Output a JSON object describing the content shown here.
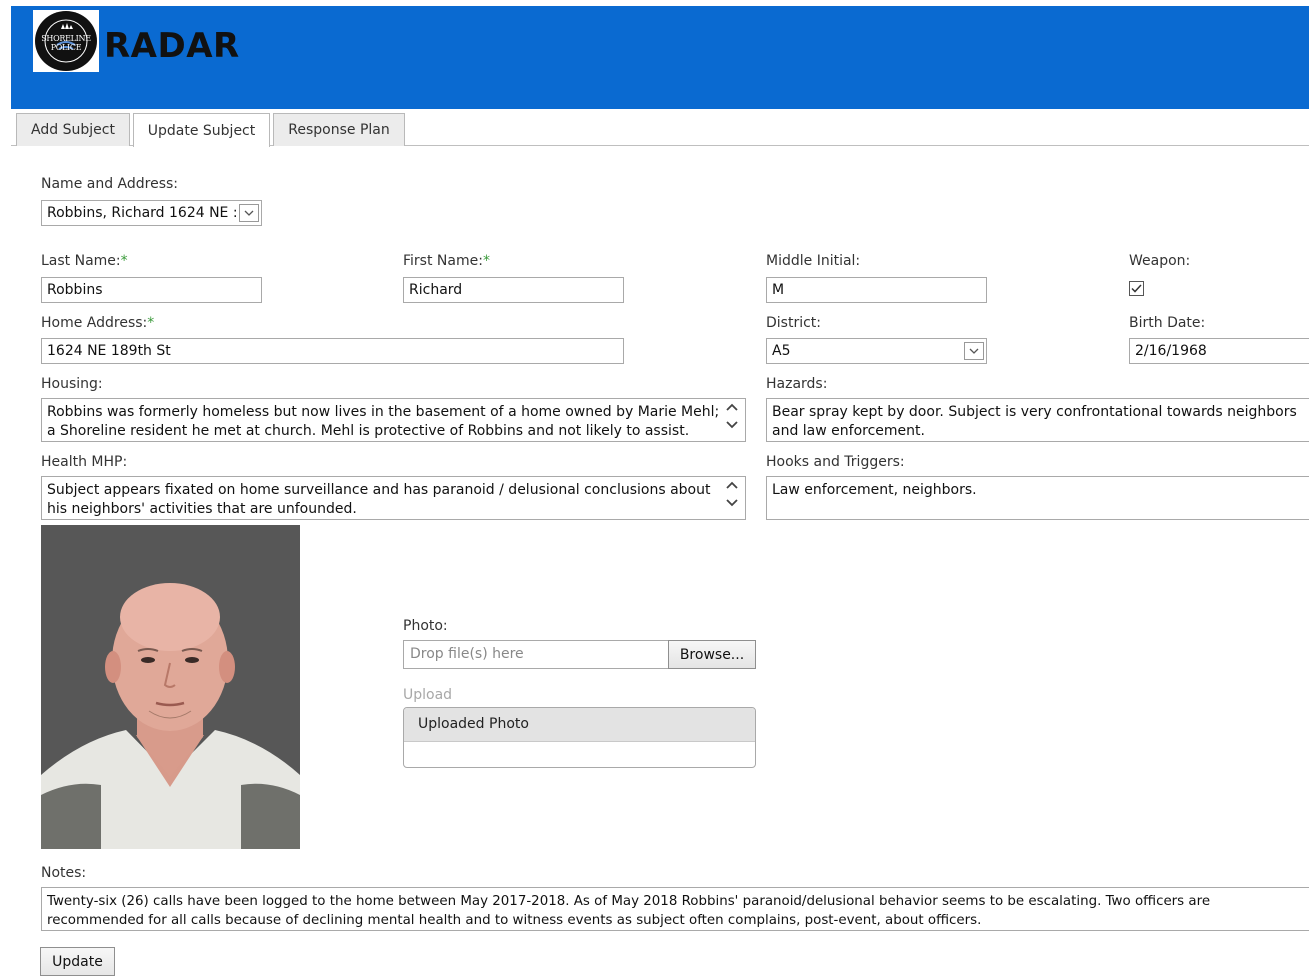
{
  "header": {
    "app_title": "RADAR",
    "logo_text": "SHORELINE POLICE"
  },
  "tabs": [
    {
      "label": "Add Subject",
      "active": false
    },
    {
      "label": "Update Subject",
      "active": true
    },
    {
      "label": "Response Plan",
      "active": false
    }
  ],
  "form": {
    "name_address": {
      "label": "Name and Address:",
      "value": "Robbins, Richard 1624 NE :"
    },
    "last_name": {
      "label": "Last Name:",
      "required_mark": "*",
      "value": "Robbins"
    },
    "first_name": {
      "label": "First Name:",
      "required_mark": "*",
      "value": "Richard"
    },
    "middle_initial": {
      "label": "Middle Initial:",
      "value": "M"
    },
    "weapon": {
      "label": "Weapon:",
      "checked": true
    },
    "home_address": {
      "label": "Home Address:",
      "required_mark": "*",
      "value": "1624 NE 189th St"
    },
    "district": {
      "label": "District:",
      "value": "A5"
    },
    "birth_date": {
      "label": "Birth Date:",
      "value": "2/16/1968"
    },
    "housing": {
      "label": "Housing:",
      "line1": "Robbins was formerly homeless but now lives in the basement of a home owned by Marie Mehl;",
      "line2": "a Shoreline resident he met at church.  Mehl is protective of Robbins and not likely to assist."
    },
    "hazards": {
      "label": "Hazards:",
      "line1": "Bear spray kept by door.  Subject is very confrontational towards neighbors",
      "line2": "and law enforcement."
    },
    "health_mhp": {
      "label": "Health MHP:",
      "line1": "Subject appears fixated on home surveillance and has paranoid / delusional conclusions about",
      "line2": "his neighbors' activities that are unfounded."
    },
    "hooks_triggers": {
      "label": "Hooks and Triggers:",
      "value": "Law enforcement, neighbors."
    },
    "photo": {
      "label": "Photo:",
      "placeholder": "Drop file(s) here",
      "browse_label": "Browse..."
    },
    "upload": {
      "label": "Upload",
      "panel_title": "Uploaded Photo"
    },
    "notes": {
      "label": "Notes:",
      "line1": "Twenty-six (26) calls have been logged to the home between May 2017-2018.  As of May 2018 Robbins' paranoid/delusional behavior seems to be escalating.  Two officers are",
      "line2": "recommended for all calls because of declining mental health and to witness events as subject often complains, post-event, about officers."
    },
    "update_button": "Update"
  },
  "colors": {
    "header_bg": "#0a6ad1",
    "required": "#3a9a3a"
  }
}
